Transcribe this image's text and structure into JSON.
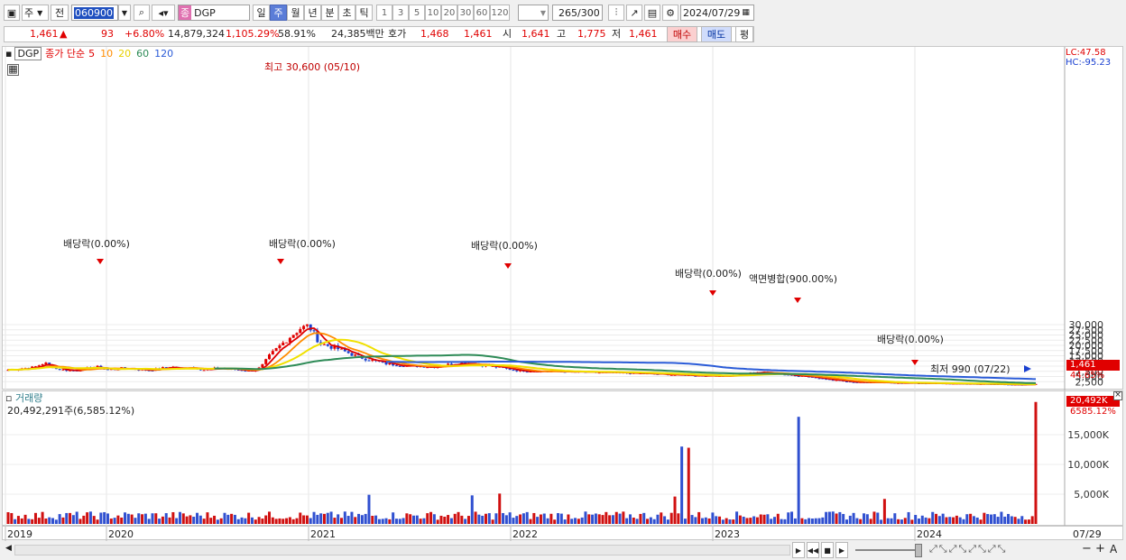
{
  "toolbar": {
    "market": "주",
    "prev_label": "전",
    "code": "060900",
    "name_badge": "종",
    "name": "DGP",
    "period_tabs": [
      "일",
      "주",
      "월",
      "년",
      "분",
      "초",
      "틱"
    ],
    "selected_period": "주",
    "intervals": [
      "1",
      "3",
      "5",
      "10",
      "20",
      "30",
      "60",
      "120"
    ],
    "count": "265",
    "count_total": "/300",
    "date": "2024/07/29"
  },
  "quote": {
    "price": "1,461",
    "change_symbol": "▲",
    "change": "93",
    "change_pct": "+6.80%",
    "volume": "14,879,324",
    "volume_ratio": "1,105.29%",
    "turnover": "58.91%",
    "amount": "24,385백만",
    "ask_label": "호가",
    "ask1": "1,468",
    "ask2": "1,461",
    "open_label": "시",
    "open": "1,641",
    "high_label": "고",
    "high": "1,775",
    "low_label": "저",
    "low": "1,461",
    "buy_label": "매수",
    "sell_label": "매도",
    "eval_label": "평"
  },
  "legend": {
    "code": "DGP",
    "series_label": "종가 단순",
    "ma": [
      {
        "period": "5",
        "color": "#e00000"
      },
      {
        "period": "10",
        "color": "#ff8c00"
      },
      {
        "period": "20",
        "color": "#f0e000"
      },
      {
        "period": "60",
        "color": "#2e8b57"
      },
      {
        "period": "120",
        "color": "#2a5bd7"
      }
    ]
  },
  "right_info": {
    "lc": "LC:47.58",
    "hc": "HC:-95.23"
  },
  "price_axis": [
    "30,000",
    "27,500",
    "25,000",
    "22,500",
    "20,000",
    "17,500",
    "15,000",
    "12,500",
    "10,000",
    "7,500",
    "5,000",
    "2,500"
  ],
  "current_price_tag": "1,461",
  "current_pct": "44.65%",
  "annotations": {
    "high": "최고 30,600 (05/10)",
    "low": "최저 990 (07/22)",
    "dividends": [
      "배당락(0.00%)",
      "배당락(0.00%)",
      "배당락(0.00%)",
      "배당락(0.00%)",
      "배당락(0.00%)"
    ],
    "merger": "액면병합(900.00%)"
  },
  "volume_panel": {
    "title": "거래량",
    "value": "20,492,291주(6,585.12%)",
    "tag": "20,492K",
    "tag_pct": "6585.12%",
    "axis": [
      "15,000K",
      "10,000K",
      "5,000K"
    ]
  },
  "x_axis": {
    "years": [
      "2019",
      "2020",
      "2021",
      "2022",
      "2023",
      "2024"
    ],
    "last_date": "07/29"
  },
  "colors": {
    "up": "#e00000",
    "down": "#1a40d0",
    "ma5": "#e00000",
    "ma10": "#ff8c00",
    "ma20": "#f0e000",
    "ma60": "#2e8b57",
    "ma120": "#2a5bd7",
    "volume_up": "#d01010",
    "volume_down": "#3050d0"
  }
}
